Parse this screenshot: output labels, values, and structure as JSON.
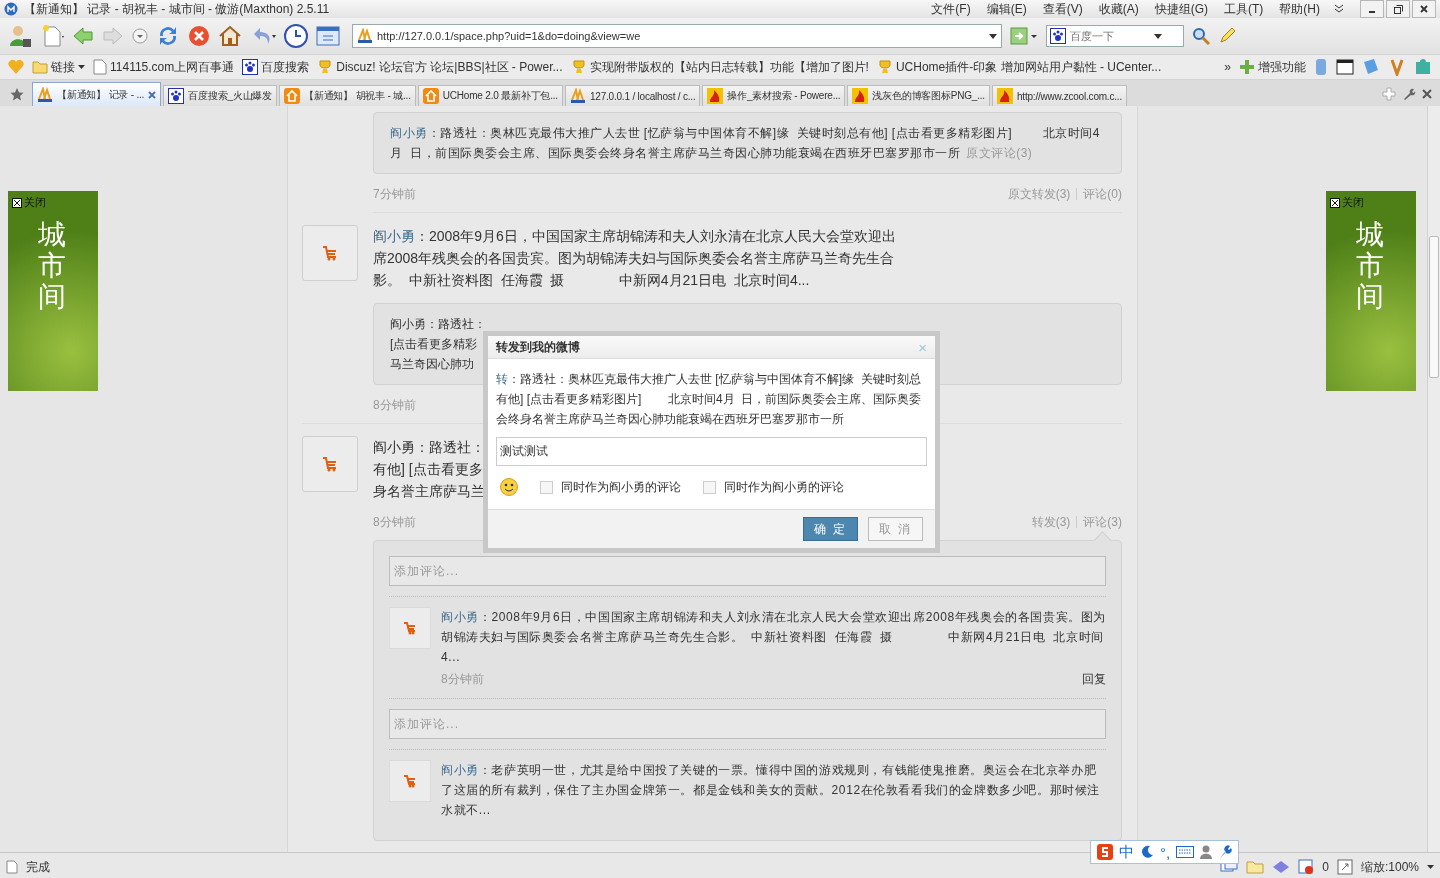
{
  "window": {
    "title": "【新通知】 记录 - 胡祝丰 - 城市间 - 傲游(Maxthon) 2.5.11",
    "menu": [
      "文件(F)",
      "编辑(E)",
      "查看(V)",
      "收藏(A)",
      "快捷组(G)",
      "工具(T)",
      "帮助(H)"
    ]
  },
  "address_bar": {
    "url": "http://127.0.0.1/space.php?uid=1&do=doing&view=we"
  },
  "search": {
    "placeholder": "百度一下"
  },
  "bookmarks": {
    "folder": "链接",
    "items": [
      {
        "label": "114115.com上网百事通",
        "kind": "page"
      },
      {
        "label": "百度搜索",
        "kind": "paw"
      },
      {
        "label": "Discuz! 论坛官方 论坛|BBS|社区 - Power...",
        "kind": "cup"
      },
      {
        "label": "实现附带版权的【站内日志转载】功能【增加了图片!",
        "kind": "cup"
      },
      {
        "label": "UCHome插件-印象 增加网站用户黏性 - UCenter...",
        "kind": "cup"
      }
    ],
    "more": "»",
    "plugin": "增强功能"
  },
  "tabs": [
    {
      "label": "【新通知】 记录 - ...",
      "kind": "pma",
      "selected": true
    },
    {
      "label": "百度搜索_火山爆发",
      "kind": "paw",
      "selected": false
    },
    {
      "label": "【新通知】 胡祝丰 - 城...",
      "kind": "home",
      "selected": false
    },
    {
      "label": "UCHome 2.0 最新补丁包...",
      "kind": "home",
      "selected": false
    },
    {
      "label": "127.0.0.1 / localhost / c...",
      "kind": "pma",
      "selected": false
    },
    {
      "label": "操作_素材搜索 - Powere...",
      "kind": "z",
      "selected": false
    },
    {
      "label": "浅灰色的博客图标PNG_...",
      "kind": "z",
      "selected": false
    },
    {
      "label": "http://www.zcool.com.c...",
      "kind": "z",
      "selected": false
    }
  ],
  "banners": [
    {
      "close": "关闭",
      "title": "城市间"
    },
    {
      "close": "关闭",
      "title": "城市间"
    }
  ],
  "posts": [
    {
      "kind": "quote_only",
      "quote": {
        "author": "阎小勇",
        "text": "：路透社：奥林匹克最伟大推广人去世 [忆萨翁与中国体育不解]缘  关键时刻总有他] [点击看更多精彩图片]        北京时间4月  日，前国际奥委会主席、国际奥委会终身名誉主席萨马兰奇因心肺功能衰竭在西班牙巴塞罗那市一所",
        "link": "原文评论(3)"
      },
      "time": "7分钟前",
      "actions": [
        "原文转发(3)",
        "评论(0)"
      ]
    },
    {
      "kind": "full",
      "author": "阎小勇",
      "text": "：2008年9月6日，中国国家主席胡锦涛和夫人刘永清在北京人民大会堂欢迎出席2008年残奥会的各国贵宾。图为胡锦涛夫妇与国际奥委会名誉主席萨马兰奇先生合影。  中新社资料图  任海霞  摄              中新网4月21日电  北京时间4...",
      "quote_lines": [
        "阎小勇：路透社：",
        "[点击看更多精彩",
        "马兰奇因心肺功"
      ],
      "time": "8分钟前"
    },
    {
      "kind": "covered",
      "lines": [
        "阎小勇：路透社：",
        "有他] [点击看更多",
        "身名誉主席萨马兰"
      ],
      "time": "8分钟前",
      "actions": [
        "转发(3)",
        "评论(3)"
      ],
      "comments": [
        {
          "kind": "input",
          "placeholder": "添加评论..."
        },
        {
          "kind": "comment",
          "author": "阎小勇",
          "text": "：2008年9月6日，中国国家主席胡锦涛和夫人刘永清在北京人民大会堂欢迎出席2008年残奥会的各国贵宾。图为胡锦涛夫妇与国际奥委会名誉主席萨马兰奇先生合影。  中新社资料图  任海霞  摄              中新网4月21日电  北京时间4...",
          "time": "8分钟前",
          "reply": "回复"
        },
        {
          "kind": "input",
          "placeholder": "添加评论..."
        },
        {
          "kind": "comment",
          "author": "阎小勇",
          "text": "：老萨英明一世，尤其是给中国投了关键的一票。懂得中国的游戏规则，有钱能使鬼推磨。奥运会在北京举办肥了这届的所有裁判，保住了主办国金牌第一。都是金钱和美女的贡献。2012在伦敦看看我们的金牌数多少吧。那时候注水就不..."
        }
      ]
    }
  ],
  "dialog": {
    "title": "转发到我的微博",
    "close": "×",
    "prefix": "转",
    "text": "：路透社：奥林匹克最伟大推广人去世 [忆萨翁与中国体育不解]缘  关键时刻总有他] [点击看更多精彩图片]        北京时间4月  日，前国际奥委会主席、国际奥委会终身名誉主席萨马兰奇因心肺功能衰竭在西班牙巴塞罗那市一所",
    "value": "测试测试",
    "options": [
      {
        "label": "同时作为阎小勇的评论",
        "checked": false
      },
      {
        "label": "同时作为阎小勇的评论",
        "checked": false
      }
    ],
    "buttons": [
      {
        "label": "确 定",
        "kind": "primary"
      },
      {
        "label": "取 消",
        "kind": "secondary"
      }
    ]
  },
  "status_bar": {
    "status": "完成",
    "ime": [
      "中",
      "°,"
    ],
    "count": "0",
    "zoom": "缩放:100%"
  }
}
